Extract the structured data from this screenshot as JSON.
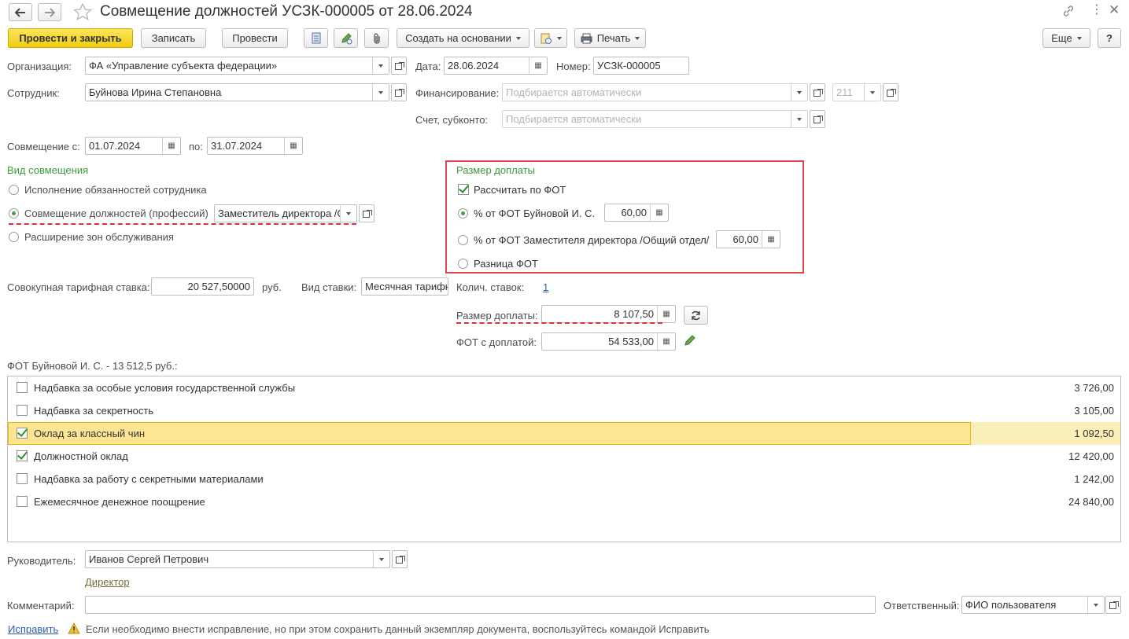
{
  "window": {
    "title": "Совмещение должностей УСЗК-000005 от 28.06.2024"
  },
  "toolbar": {
    "post_close": "Провести и закрыть",
    "save": "Записать",
    "post": "Провести",
    "create_based": "Создать на основании",
    "print": "Печать",
    "more": "Еще",
    "help": "?"
  },
  "header": {
    "org_label": "Организация:",
    "org_value": "ФА «Управление субъекта федерации»",
    "date_label": "Дата:",
    "date_value": "28.06.2024",
    "number_label": "Номер:",
    "number_value": "УСЗК-000005",
    "employee_label": "Сотрудник:",
    "employee_value": "Буйнова Ирина Степановна",
    "financing_label": "Финансирование:",
    "financing_placeholder": "Подбирается автоматически",
    "financing_code": "211",
    "account_label": "Счет, субконто:",
    "account_placeholder": "Подбирается автоматически",
    "combine_from_label": "Совмещение с:",
    "combine_from": "01.07.2024",
    "combine_to_label": "по:",
    "combine_to": "31.07.2024"
  },
  "combination_type": {
    "title": "Вид совмещения",
    "options": [
      "Исполнение обязанностей сотрудника",
      "Совмещение должностей (профессий)",
      "Расширение зон обслуживания"
    ],
    "selected_index": 1,
    "position_value": "Заместитель директора /С"
  },
  "surcharge": {
    "title": "Размер доплаты",
    "calc_by_fot_label": "Рассчитать по ФОТ",
    "calc_by_fot_checked": true,
    "opt1_label": "% от ФОТ Буйновой И. С.",
    "opt1_value": "60,00",
    "opt2_label": "% от ФОТ Заместителя директора /Общий отдел/",
    "opt2_value": "60,00",
    "opt3_label": "Разница ФОТ",
    "selected_index": 0
  },
  "rates": {
    "total_rate_label": "Совокупная тарифная ставка:",
    "total_rate_value": "20 527,50000",
    "currency": "руб.",
    "rate_type_label": "Вид ставки:",
    "rate_type_value": "Месячная тарифн",
    "count_label": "Колич. ставок:",
    "count_value": "1",
    "surcharge_amount_label": "Размер доплаты:",
    "surcharge_amount_value": "8 107,50",
    "fot_with_surcharge_label": "ФОТ с доплатой:",
    "fot_with_surcharge_value": "54 533,00"
  },
  "fot_table": {
    "caption": "ФОТ Буйновой И. С. - 13 512,5 руб.:",
    "rows": [
      {
        "name": "Надбавка за особые условия государственной службы",
        "value": "3 726,00",
        "checked": false
      },
      {
        "name": "Надбавка за секретность",
        "value": "3 105,00",
        "checked": false
      },
      {
        "name": "Оклад за классный чин",
        "value": "1 092,50",
        "checked": true
      },
      {
        "name": "Должностной оклад",
        "value": "12 420,00",
        "checked": true
      },
      {
        "name": "Надбавка за работу с секретными материалами",
        "value": "1 242,00",
        "checked": false
      },
      {
        "name": "Ежемесячное денежное поощрение",
        "value": "24 840,00",
        "checked": false
      }
    ],
    "selected_index": 2
  },
  "footer": {
    "manager_label": "Руководитель:",
    "manager_value": "Иванов Сергей Петрович",
    "manager_position": "Директор",
    "comment_label": "Комментарий:",
    "comment_value": "",
    "responsible_label": "Ответственный:",
    "responsible_value": "ФИО пользователя",
    "fix_link": "Исправить",
    "fix_hint": "Если необходимо внести исправление, но при этом сохранить данный экземпляр документа, воспользуйтесь командой Исправить"
  },
  "colors": {
    "primary_button": "#f0cd0f",
    "group_title": "#3c9a3c",
    "highlight_box": "#e0464b",
    "selected_row": "#fde594",
    "link": "#2a5db0"
  }
}
